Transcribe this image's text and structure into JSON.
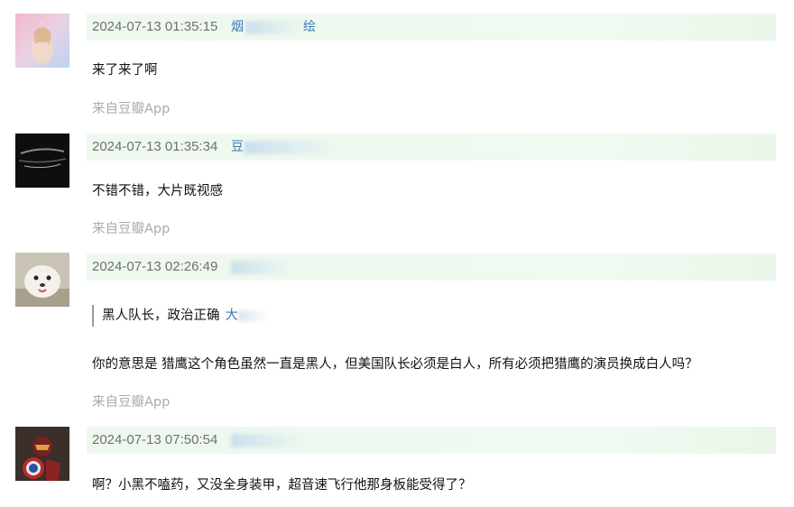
{
  "comments": [
    {
      "timestamp": "2024-07-13 01:35:15",
      "username_visible": "烟",
      "username_tail": "绘",
      "content": "来了来了啊",
      "source": "来自豆瓣App"
    },
    {
      "timestamp": "2024-07-13 01:35:34",
      "username_visible": "豆",
      "content": "不错不错，大片既视感",
      "source": "来自豆瓣App"
    },
    {
      "timestamp": "2024-07-13 02:26:49",
      "username_visible": "",
      "quote_text": "黑人队长，政治正确",
      "quote_author_visible": "大",
      "content": "你的意思是 猎鹰这个角色虽然一直是黑人，但美国队长必须是白人，所有必须把猎鹰的演员换成白人吗？",
      "source": "来自豆瓣App"
    },
    {
      "timestamp": "2024-07-13 07:50:54",
      "username_visible": "",
      "content": "啊？小黑不嗑药，又没全身装甲，超音速飞行他那身板能受得了？"
    }
  ],
  "colors": {
    "meta_bg": "#eef8ee",
    "username": "#3a7bb5",
    "source_text": "#aaaaaa",
    "timestamp": "#707070"
  }
}
